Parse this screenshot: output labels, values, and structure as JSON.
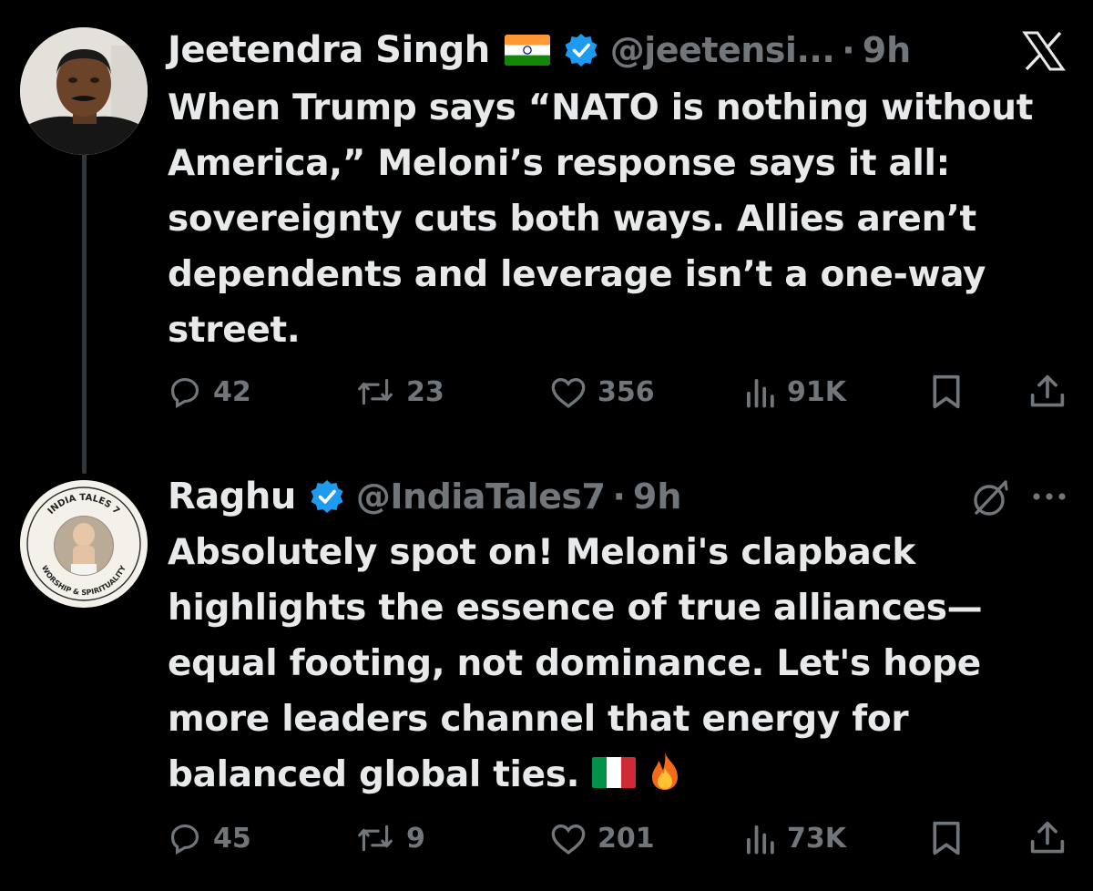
{
  "tweets": [
    {
      "author": {
        "name": "Jeetendra Singh",
        "handle": "@jeetensi...",
        "time": "9h",
        "flag": "india-flag-emoji",
        "verified": true,
        "avatar": "photo-of-man-avatar"
      },
      "text": "When Trump says “NATO is nothing without America,” Meloni’s response says it all: sovereignty cuts both ways. Allies aren’t dependents and leverage isn’t a one-way street.",
      "stats": {
        "replies": "42",
        "reposts": "23",
        "likes": "356",
        "views": "91K"
      }
    },
    {
      "author": {
        "name": "Raghu",
        "handle": "@IndiaTales7",
        "time": "9h",
        "verified": true,
        "avatar": "india-tales-7-logo",
        "avatar_text_top": "INDIA TALES 7",
        "avatar_text_bottom": "WORSHIP & SPIRITUALITY"
      },
      "text": "Absolutely spot on! Meloni's clapback highlights the essence of true alliances—equal footing, not dominance. Let's hope more leaders channel that energy for balanced global ties.",
      "trailing_emoji": [
        "italy-flag-emoji",
        "fire-emoji"
      ],
      "stats": {
        "replies": "45",
        "reposts": "9",
        "likes": "201",
        "views": "73K"
      }
    }
  ],
  "chrome": {
    "dot_separator": "·",
    "icons": [
      "x-logo-icon",
      "grok-icon",
      "more-icon"
    ]
  },
  "colors": {
    "background": "#000000",
    "text": "#e7e9ea",
    "secondary": "#71767b",
    "verified": "#1d9bf0",
    "thread_line": "#333639"
  }
}
